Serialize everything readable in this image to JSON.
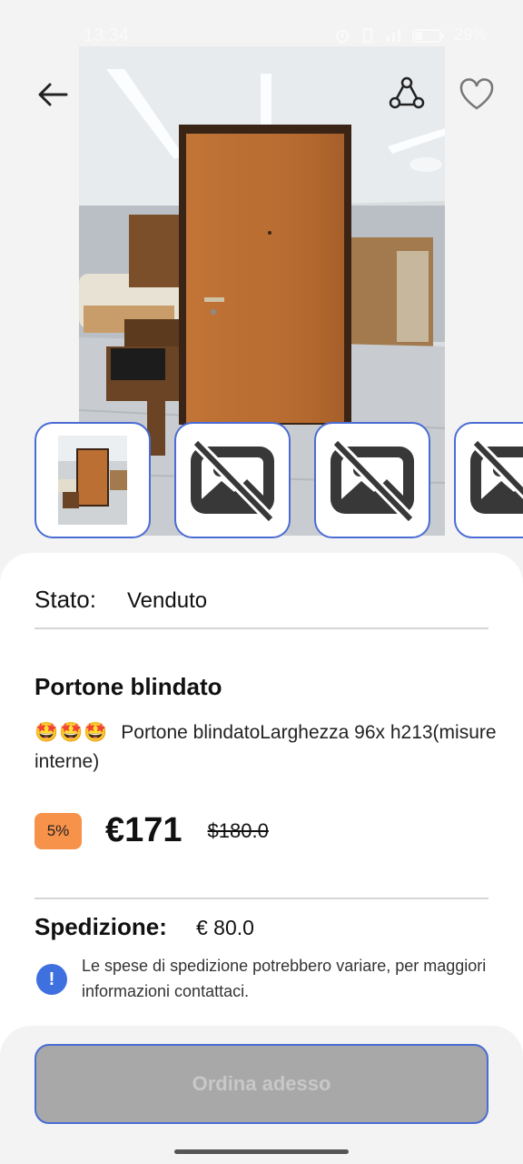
{
  "status_bar": {
    "time": "13:34",
    "battery": "29%",
    "icons": [
      "alarm-icon",
      "vibrate-icon",
      "signal-icon",
      "battery-icon"
    ]
  },
  "header": {
    "back_icon": "arrow-left-icon",
    "share_icon": "share-icon",
    "favorite_icon": "heart-icon"
  },
  "gallery": {
    "main_image": "armored-door-photo",
    "thumbnails": [
      {
        "kind": "photo"
      },
      {
        "kind": "image-unavailable-icon"
      },
      {
        "kind": "image-unavailable-icon"
      },
      {
        "kind": "image-unavailable-icon"
      }
    ]
  },
  "product": {
    "status_label": "Stato:",
    "status_value": "Venduto",
    "title": "Portone blindato",
    "emojis": "🤩🤩🤩",
    "description": "Portone blindatoLarghezza 96x h213(misure interne)",
    "discount": "5%",
    "price": "€171",
    "old_price": "$180.0"
  },
  "shipping": {
    "label": "Spedizione:",
    "value": "€ 80.0",
    "note": "Le spese di spedizione potrebbero variare, per maggiori informazioni contattaci."
  },
  "actions": {
    "order_label": "Ordina adesso"
  },
  "colors": {
    "accent": "#4a6cd4",
    "discount_badge": "#f7924a",
    "info_icon": "#3f70e0",
    "disabled_button": "#a8a8a8"
  }
}
